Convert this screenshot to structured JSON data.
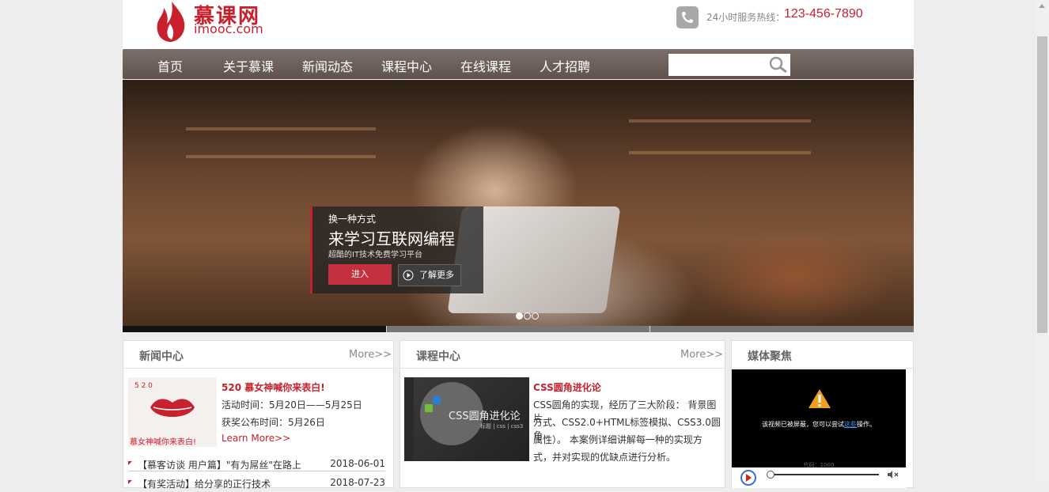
{
  "header": {
    "logo_title": "慕课网",
    "logo_sub": "imooc.com",
    "hotline_label": "24小时服务热线：",
    "hotline_number": "123-456-7890"
  },
  "nav": {
    "items": [
      "首页",
      "关于慕课",
      "新闻动态",
      "课程中心",
      "在线课程",
      "人才招聘"
    ],
    "search_placeholder": ""
  },
  "banner": {
    "line1": "换一种方式",
    "line2": "来学习互联网编程",
    "line3": "超酷的IT技术免费学习平台",
    "enter_label": "进入",
    "more_label": "了解更多",
    "slides_total": 3,
    "active_slide": 1
  },
  "news": {
    "title": "新闻中心",
    "more": "More>>",
    "featured_title": "520 慕女神喊你来表白!",
    "featured_line1": "活动时间：5月20日——5月25日",
    "featured_line2": "获奖公布时间：5月26日",
    "featured_link": "Learn More>>",
    "thumb_text_top": "5  2  0",
    "thumb_text_bottom": "慕女神喊你来表白!",
    "rows": [
      {
        "title": "【慕客访谈 用户篇】\"有为屌丝\"在路上",
        "date": "2018-06-01"
      },
      {
        "title": "【有奖活动】给分享的正行技术",
        "date": "2018-07-23"
      }
    ]
  },
  "courses": {
    "title": "课程中心",
    "more": "More>>",
    "featured_title": "CSS圆角进化论",
    "desc": [
      "CSS圆角的实现，经历了三大阶段： 背景图片",
      "方式、CSS2.0+HTML标签模拟、CSS3.0圆角",
      "属性）。 本案例详细讲解每一种的实现方",
      "式，并对实现的优缺点进行分析。"
    ],
    "thumb_text": "CSS圆角进化论",
    "thumb_sub": "标题 | css | css3"
  },
  "media": {
    "title": "媒体聚焦",
    "video_msg_pre": "该视频已被屏蔽，您可以尝试",
    "video_msg_link": "这些",
    "video_msg_post": "操作。",
    "video_code": "代码：1000"
  },
  "colors": {
    "brand_red": "#c8202c",
    "nav_bg": "#6e625d"
  }
}
